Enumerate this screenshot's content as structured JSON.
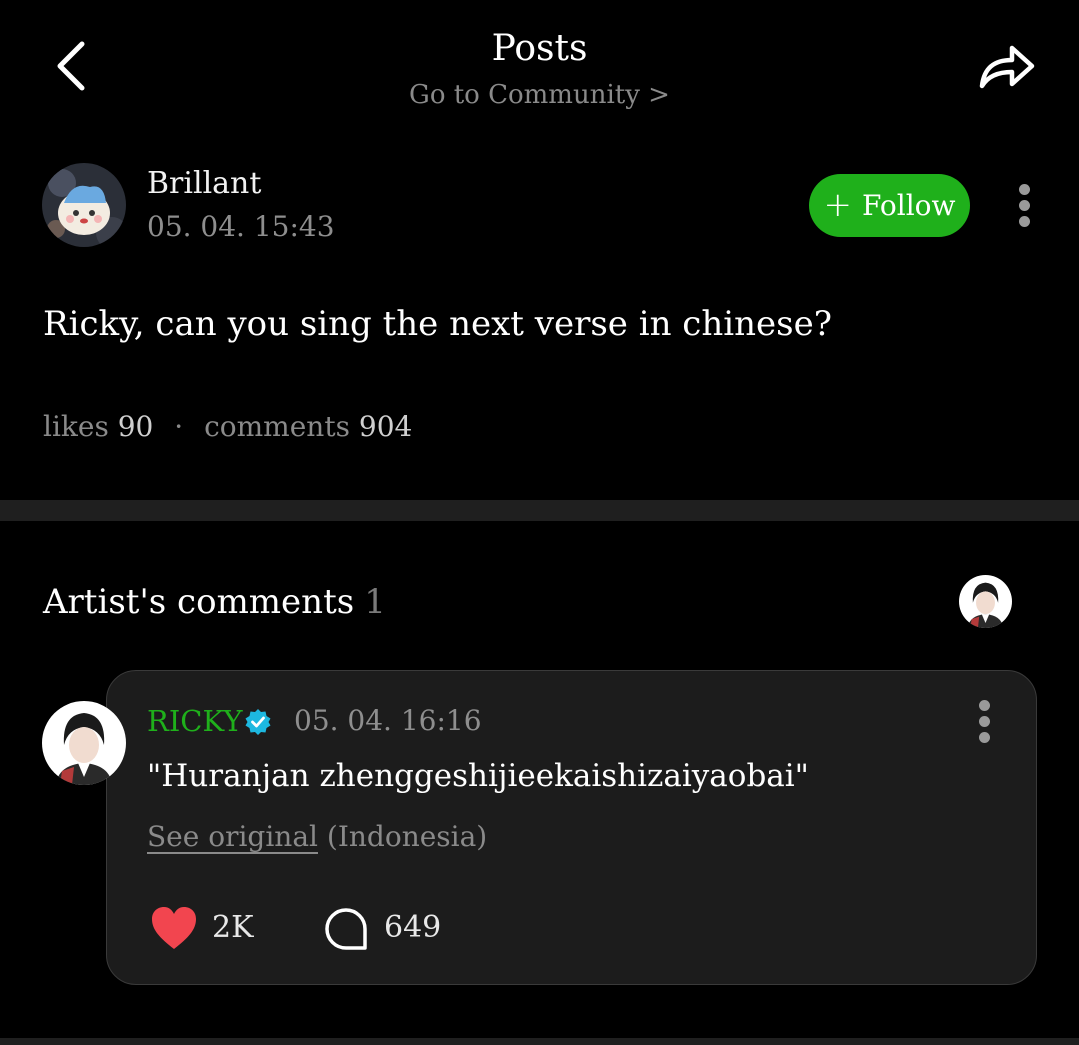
{
  "header": {
    "title": "Posts",
    "community_link": "Go to Community >"
  },
  "post": {
    "author": "Brillant",
    "time": "05. 04. 15:43",
    "follow_label": "Follow",
    "body": "Ricky, can you sing the next verse in chinese?",
    "likes_label": "likes",
    "likes_count": "90",
    "comments_label": "comments",
    "comments_count": "904"
  },
  "artist_comments": {
    "title": "Artist's comments",
    "count": "1",
    "comment": {
      "author": "RICKY",
      "time": "05. 04. 16:16",
      "text": "\"Huranjan zhenggeshijieekaishizaiyaobai\"",
      "see_original": "See original",
      "language": "(Indonesia)",
      "likes": "2K",
      "replies": "649"
    }
  },
  "colors": {
    "accent_green": "#1fb01b",
    "heart_red": "#f2454f",
    "verified_blue": "#1db8e0"
  },
  "icons": [
    "back-arrow-icon",
    "share-icon",
    "more-vertical-icon",
    "plus-icon",
    "verified-badge-icon",
    "heart-icon",
    "comment-bubble-icon"
  ]
}
